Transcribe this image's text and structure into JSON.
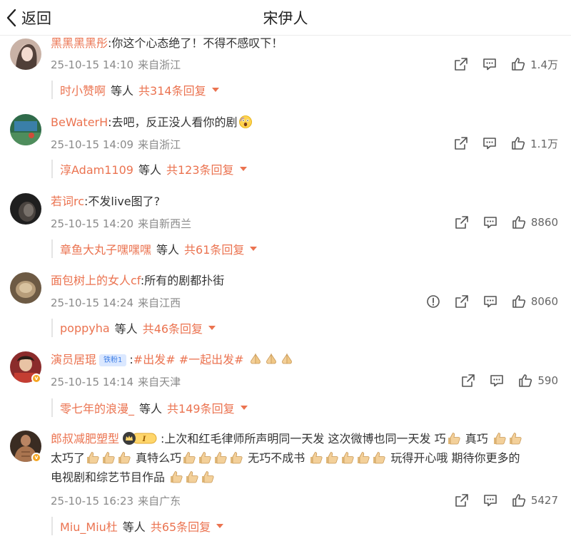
{
  "header": {
    "back_label": "返回",
    "title": "宋伊人"
  },
  "colors": {
    "accent": "#eb7350",
    "meta": "#8a8a8a",
    "icon": "#555555"
  },
  "comments": [
    {
      "username": "黑黑黑黑彤",
      "text": ":你这个心态绝了！不得不感叹下！",
      "time": "25-10-15 14:10",
      "location": "来自浙江",
      "likes": "1.4万",
      "reply_user": "时小赞啊",
      "reply_mid": "等人",
      "reply_total": "共314条回复"
    },
    {
      "username": "BeWaterH",
      "text": ":去吧，反正没人看你的剧",
      "time": "25-10-15 14:09",
      "location": "来自浙江",
      "likes": "1.1万",
      "reply_user": "淳Adam1109",
      "reply_mid": "等人",
      "reply_total": "共123条回复"
    },
    {
      "username": "若词rc",
      "text": ":不发live图了?",
      "time": "25-10-15 14:20",
      "location": "来自新西兰",
      "likes": "8860",
      "reply_user": "章鱼大丸子嘿嘿嘿",
      "reply_mid": "等人",
      "reply_total": "共61条回复"
    },
    {
      "username": "面包树上的女人cf",
      "text": ":所有的剧都扑街",
      "time": "25-10-15 14:24",
      "location": "来自江西",
      "likes": "8060",
      "reply_user": "poppyha",
      "reply_mid": "等人",
      "reply_total": "共46条回复"
    },
    {
      "username": "演员居琨",
      "badge": "铁粉1",
      "text_pre": ":",
      "tags": [
        "#出发#",
        "#一起出发#"
      ],
      "time": "25-10-15 14:14",
      "location": "来自天津",
      "likes": "590",
      "reply_user": "零七年的浪漫_",
      "reply_mid": "等人",
      "reply_total": "共149条回复"
    },
    {
      "username": "郎叔减肥塑型",
      "text_a": ":上次和红毛律师所声明同一天发  这次微博也同一天发  巧",
      "text_b": "真巧",
      "text_c": "太巧了",
      "text_d": "真特么巧",
      "text_e": "无巧不成书",
      "text_f": "玩得开心哦  期待你更多的",
      "text_g": "电视剧和综艺节目作品",
      "time": "25-10-15 16:23",
      "location": "来自广东",
      "likes": "5427",
      "reply_user": "Miu_Miu杜",
      "reply_mid": "等人",
      "reply_total": "共65条回复"
    }
  ]
}
